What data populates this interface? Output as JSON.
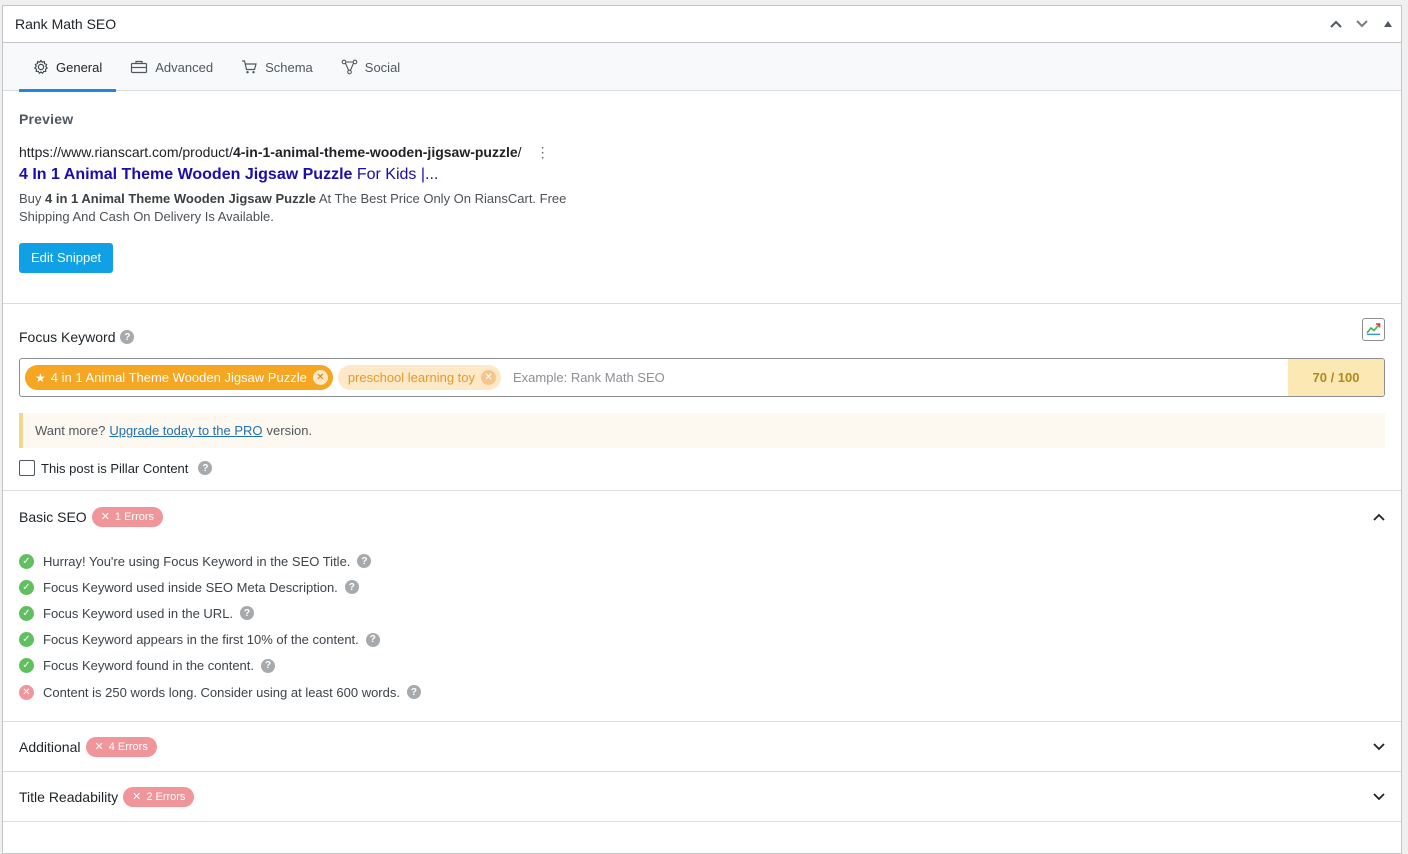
{
  "panel": {
    "title": "Rank Math SEO"
  },
  "tabs": [
    {
      "label": "General",
      "icon": "gear-icon"
    },
    {
      "label": "Advanced",
      "icon": "toolbox-icon"
    },
    {
      "label": "Schema",
      "icon": "cart-icon"
    },
    {
      "label": "Social",
      "icon": "share-icon"
    }
  ],
  "preview": {
    "label": "Preview",
    "url_base": "https://www.rianscart.com/product/",
    "url_slug": "4-in-1-animal-theme-wooden-jigsaw-puzzle",
    "url_end": "/",
    "title_bold": "4 In 1 Animal Theme Wooden Jigsaw Puzzle",
    "title_rest": " For Kids |...",
    "desc_start": "Buy ",
    "desc_bold": "4 in 1 Animal Theme Wooden Jigsaw Puzzle",
    "desc_rest": " At The Best Price Only On RiansCart. Free Shipping And Cash On Delivery Is Available.",
    "edit_button": "Edit Snippet"
  },
  "focus_keyword": {
    "label": "Focus Keyword",
    "primary_tag": "4 in 1 Animal Theme Wooden Jigsaw Puzzle",
    "secondary_tag": "preschool learning toy",
    "placeholder": "Example: Rank Math SEO",
    "score": "70 / 100",
    "notice_start": "Want more?",
    "notice_link": "Upgrade today to the PRO",
    "notice_end": "version.",
    "pillar_label": "This post is Pillar Content"
  },
  "basic_seo": {
    "title": "Basic SEO",
    "badge": "1 Errors",
    "checks": [
      {
        "text": "Hurray! You're using Focus Keyword in the SEO Title.",
        "status": "ok"
      },
      {
        "text": "Focus Keyword used inside SEO Meta Description.",
        "status": "ok"
      },
      {
        "text": "Focus Keyword used in the URL.",
        "status": "ok"
      },
      {
        "text": "Focus Keyword appears in the first 10% of the content.",
        "status": "ok"
      },
      {
        "text": "Focus Keyword found in the content.",
        "status": "ok"
      },
      {
        "text": "Content is 250 words long. Consider using at least 600 words.",
        "status": "error"
      }
    ]
  },
  "additional": {
    "title": "Additional",
    "badge": "4 Errors"
  },
  "title_readability": {
    "title": "Title Readability",
    "badge": "2 Errors"
  },
  "colors": {
    "accent": "#1e88e5",
    "primary_button": "#10a0e5",
    "tag_primary": "#f5a623",
    "error_badge": "#f0969a",
    "ok": "#60c060"
  }
}
